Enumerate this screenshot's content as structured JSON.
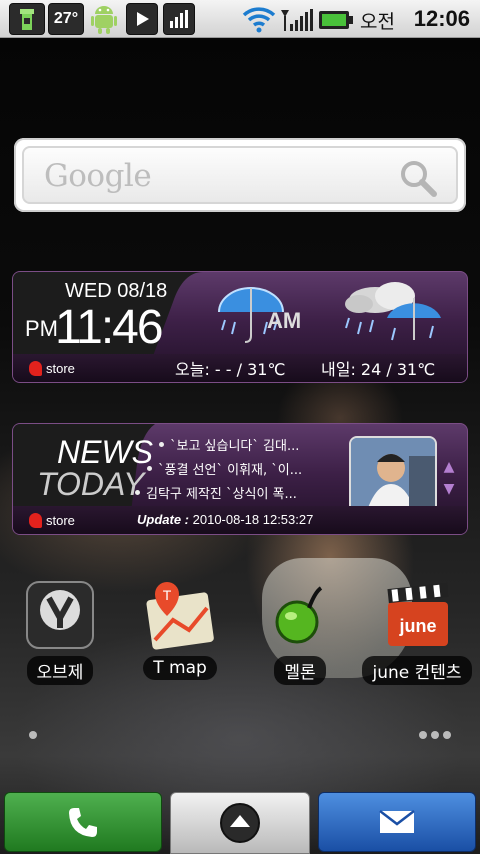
{
  "status_bar": {
    "temperature": "27°",
    "ampm": "오전",
    "time": "12:06",
    "icons": [
      "battery-tower-icon",
      "android-icon",
      "play-icon",
      "signal-bars-app-icon",
      "wifi-icon",
      "cell-signal-icon",
      "battery-icon"
    ]
  },
  "search_widget": {
    "logo": "Google",
    "icon": "magnifier-icon"
  },
  "weather_widget": {
    "date": "WED 08/18",
    "period": "PM",
    "time": "11:46",
    "weather_period": "AM",
    "today": "오늘: - - / 31℃",
    "tomorrow": "내일: 24 / 31℃",
    "provider": "store",
    "icons": [
      "umbrella-rain-icon",
      "cloud-umbrella-rain-icon"
    ]
  },
  "news_widget": {
    "title_line1": "NEWS",
    "title_line2": "TODAY",
    "items": [
      "`보고 싶습니다` 김대...",
      "`풍결 선언` 이휘재, `이...",
      "김탁구 제작진 `상식이 폭..."
    ],
    "update_label": "Update :",
    "update_time": "2010-08-18 12:53:27",
    "provider": "store"
  },
  "apps": [
    {
      "label": "오브제",
      "icon": "objet-icon"
    },
    {
      "label": "T map",
      "icon": "tmap-icon"
    },
    {
      "label": "멜론",
      "icon": "melon-icon"
    },
    {
      "label": "june 컨텐츠",
      "icon": "june-clapperboard-icon"
    }
  ],
  "dock": {
    "phone_icon": "phone-icon",
    "launcher_icon": "up-arrow-icon",
    "message_icon": "envelope-icon"
  },
  "colors": {
    "widget_purple": "#5d3a6a",
    "phone_green": "#2f9a2f",
    "message_blue": "#2a66c4",
    "tstore_red": "#e2221d"
  }
}
